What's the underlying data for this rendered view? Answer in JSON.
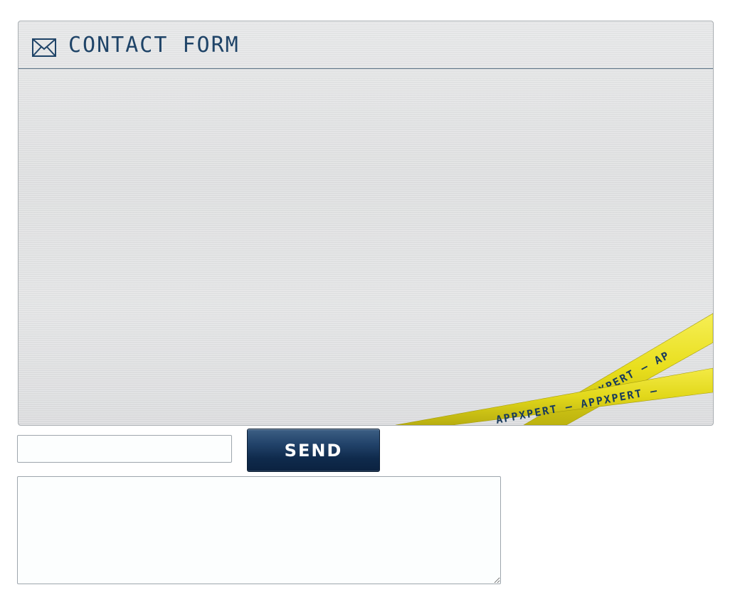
{
  "panel": {
    "title": "CONTACT FORM",
    "header_icon": "envelope-icon"
  },
  "tape": {
    "text_upper": "APPXPERT  –  AP",
    "text_upper_tail": "– AP",
    "text_lower": "APPXPERT  –  APPXPERT  –",
    "color": "#e8de1c"
  },
  "form": {
    "input_value": "",
    "input_placeholder": "",
    "send_label": "SEND",
    "textarea_value": "",
    "textarea_placeholder": ""
  },
  "colors": {
    "title": "#1f4468",
    "button": "#0f2a4c",
    "tape": "#e8de1c"
  }
}
